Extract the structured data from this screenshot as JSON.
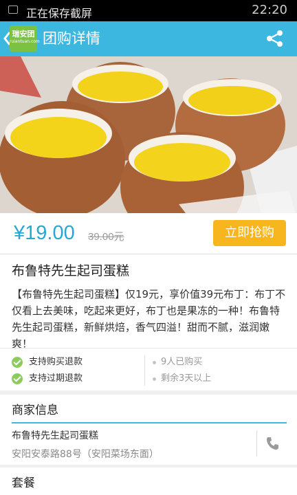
{
  "status_bar": {
    "text": "正在保存截屏",
    "time": "22:20"
  },
  "header": {
    "logo_text": "瑞安团",
    "logo_sub": "ruiantuan.com",
    "title": "团购详情",
    "back_icon": "back-arrow-icon",
    "share_icon": "share-icon"
  },
  "deal": {
    "price": "¥19.00",
    "original_price": "39.00元",
    "buy_label": "立即抢购",
    "buy_color": "#f7b51e",
    "accent_color": "#3cb8e0"
  },
  "product": {
    "name": "布鲁特先生起司蛋糕",
    "description": "【布鲁特先生起司蛋糕】仅19元，享价值39元布丁：布丁不仅看上去美味，吃起来更好，布丁也是果冻的一种！布鲁特先生起司蛋糕，新鲜烘焙，香气四溢！甜而不腻，滋润嫩爽！"
  },
  "features": [
    "支持购买退款",
    "支持过期退款"
  ],
  "stats": {
    "sold": "9人已购买",
    "remaining": "剩余3天以上"
  },
  "merchant": {
    "section_title": "商家信息",
    "name": "布鲁特先生起司蛋糕",
    "address": "安阳安泰路88号（安阳菜场东面）",
    "phone_icon": "phone-icon"
  },
  "package": {
    "section_title": "套餐"
  }
}
